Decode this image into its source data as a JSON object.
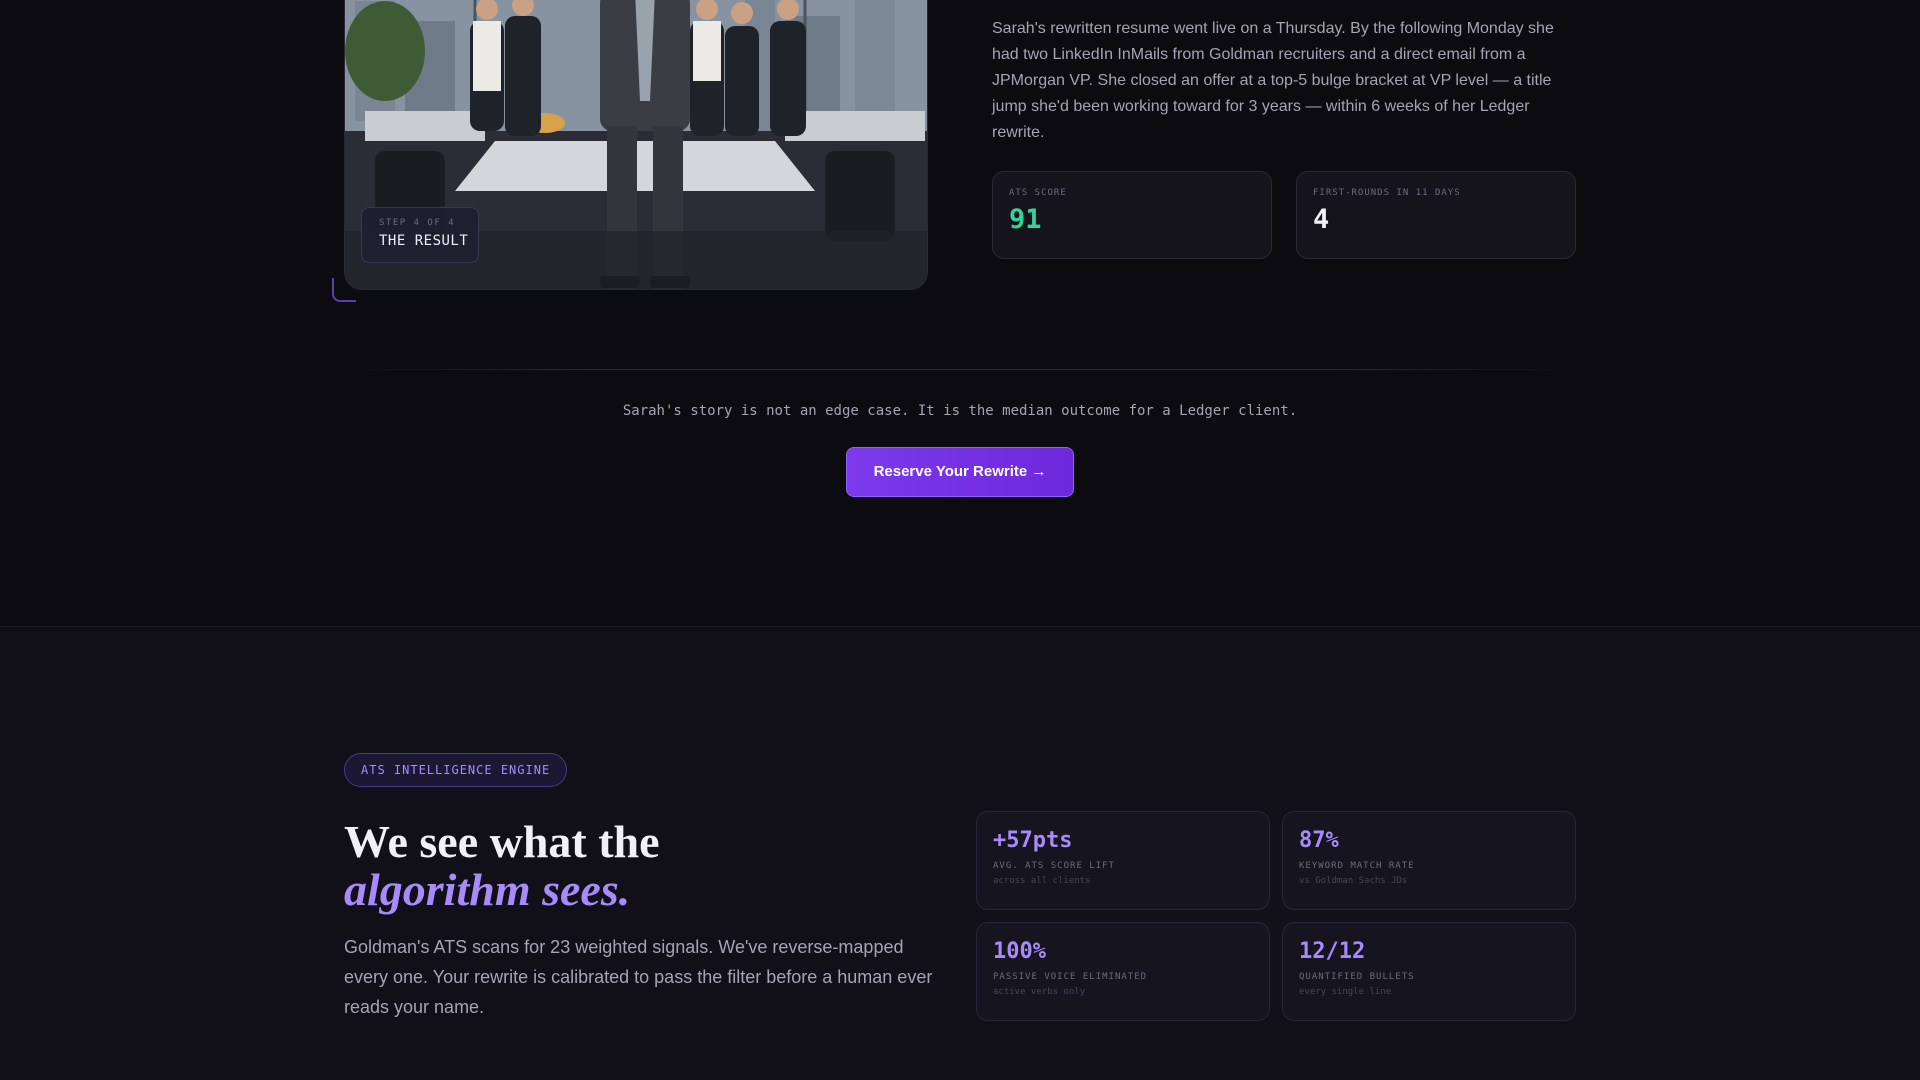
{
  "result_step": {
    "step_label": "STEP 4 OF 4",
    "title": "THE RESULT"
  },
  "story": {
    "paragraph": "Sarah's rewritten resume went live on a Thursday. By the following Monday she had two LinkedIn InMails from Goldman recruiters and a direct email from a JPMorgan VP. She closed an offer at a top-5 bulge bracket at VP level — a title jump she'd been working toward for 3 years — within 6 weeks of her Ledger rewrite."
  },
  "stats": [
    {
      "label": "ATS SCORE",
      "value": "91",
      "color": "#34d399"
    },
    {
      "label": "FIRST-ROUNDS IN 11 DAYS",
      "value": "4",
      "color": "#f1eff7"
    }
  ],
  "tagline": "Sarah's story is not an edge case. It is the median outcome for a Ledger client.",
  "cta": {
    "label": "Reserve Your Rewrite →"
  },
  "ats_section": {
    "pill": "ATS INTELLIGENCE ENGINE",
    "heading_line1": "We see what the",
    "heading_line2": "algorithm sees.",
    "body": "Goldman's ATS scans for 23 weighted signals. We've reverse-mapped every one. Your rewrite is calibrated to pass the filter before a human ever reads your name.",
    "metrics": [
      {
        "value": "+57pts",
        "label": "AVG. ATS SCORE LIFT",
        "sub": "across all clients"
      },
      {
        "value": "87%",
        "label": "KEYWORD MATCH RATE",
        "sub": "vs Goldman Sachs JDs"
      },
      {
        "value": "100%",
        "label": "PASSIVE VOICE ELIMINATED",
        "sub": "active verbs only"
      },
      {
        "value": "12/12",
        "label": "QUANTIFIED BULLETS",
        "sub": "every single line"
      }
    ]
  },
  "colors": {
    "accent": "#a78bfa",
    "cta": "#7c3aed",
    "score_green": "#34d399"
  }
}
